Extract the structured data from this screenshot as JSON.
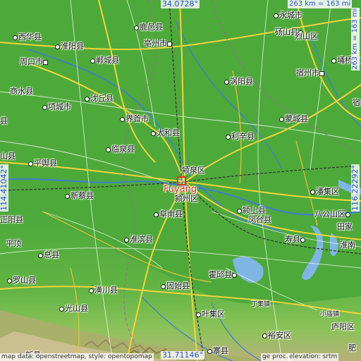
{
  "map": {
    "featured_city": "Fuyang",
    "coords": {
      "top": "34.0728°",
      "bottom": "31.71146°",
      "left": "114.41042°",
      "right": "116.22292°"
    },
    "scale": {
      "top": "263 km = 163 mi",
      "right": "263 km = 163 mi"
    },
    "attribution": "map data: openstreetmap, style: opentopomap",
    "attribution_right": "elevation: srtm",
    "attribution_mid": "ge proc.",
    "colors": {
      "lowland": "#4aa83a",
      "upland": "#7cc14f",
      "hills": "#c8b98a",
      "water": "#7fb6e6",
      "road_major": "#f0d23a",
      "road_minor": "#ffffff",
      "rail": "#333333",
      "border": "#a060a0"
    },
    "places": [
      {
        "name": "永城市",
        "kind": "city"
      },
      {
        "name": "鹿邑县",
        "kind": "town"
      },
      {
        "name": "亳州市",
        "kind": "city"
      },
      {
        "name": "砀山县",
        "kind": "town"
      },
      {
        "name": "西华县",
        "kind": "town"
      },
      {
        "name": "淮阳县",
        "kind": "town"
      },
      {
        "name": "周口市",
        "kind": "city"
      },
      {
        "name": "郸城县",
        "kind": "town"
      },
      {
        "name": "商水县",
        "kind": "town"
      },
      {
        "name": "项城市",
        "kind": "city"
      },
      {
        "name": "沈丘县",
        "kind": "town"
      },
      {
        "name": "界首市",
        "kind": "city"
      },
      {
        "name": "涡阳县",
        "kind": "town"
      },
      {
        "name": "宿州市",
        "kind": "city"
      },
      {
        "name": "埇桥区",
        "kind": "town"
      },
      {
        "name": "蒙城县",
        "kind": "town"
      },
      {
        "name": "太和县",
        "kind": "town"
      },
      {
        "name": "利辛县",
        "kind": "town"
      },
      {
        "name": "临泉县",
        "kind": "town"
      },
      {
        "name": "颍泉区",
        "kind": "town"
      },
      {
        "name": "颍州区",
        "kind": "town"
      },
      {
        "name": "平舆县",
        "kind": "town"
      },
      {
        "name": "新蔡县",
        "kind": "town"
      },
      {
        "name": "阜南县",
        "kind": "town"
      },
      {
        "name": "颍上县",
        "kind": "town"
      },
      {
        "name": "凤台县",
        "kind": "town"
      },
      {
        "name": "潘集区",
        "kind": "town"
      },
      {
        "name": "八公山区",
        "kind": "town"
      },
      {
        "name": "寿县",
        "kind": "town"
      },
      {
        "name": "正阳县",
        "kind": "town"
      },
      {
        "name": "淮滨县",
        "kind": "town"
      },
      {
        "name": "息县",
        "kind": "town"
      },
      {
        "name": "罗山县",
        "kind": "town"
      },
      {
        "name": "潢川县",
        "kind": "town"
      },
      {
        "name": "固始县",
        "kind": "town"
      },
      {
        "name": "霍邱县",
        "kind": "town"
      },
      {
        "name": "光山县",
        "kind": "town"
      },
      {
        "name": "叶集区",
        "kind": "town"
      },
      {
        "name": "丁集镇",
        "kind": "village"
      },
      {
        "name": "裕安区",
        "kind": "town"
      },
      {
        "name": "庐阳区",
        "kind": "town"
      },
      {
        "name": "小庙镇",
        "kind": "village"
      },
      {
        "name": "县",
        "kind": "town"
      },
      {
        "name": "山县",
        "kind": "town"
      },
      {
        "name": "淮南",
        "kind": "town"
      },
      {
        "name": "田家",
        "kind": "town"
      },
      {
        "name": "宿",
        "kind": "town"
      },
      {
        "name": "平顶",
        "kind": "town"
      },
      {
        "name": "烈山区",
        "kind": "town"
      },
      {
        "name": "寨县",
        "kind": "town"
      },
      {
        "name": "新县",
        "kind": "town"
      },
      {
        "name": "肥",
        "kind": "town"
      }
    ]
  }
}
